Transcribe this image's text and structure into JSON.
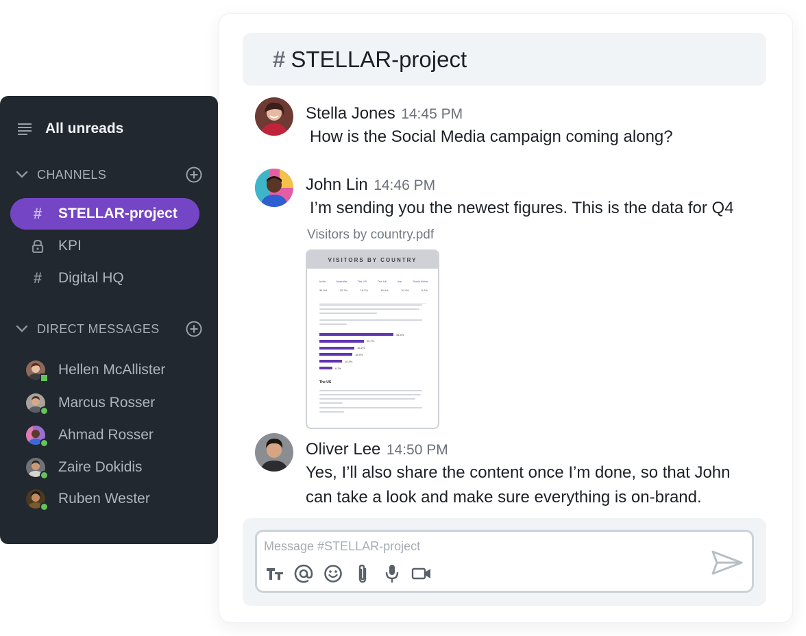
{
  "channel": {
    "hash": "#",
    "name": "STELLAR-project"
  },
  "messages": [
    {
      "author": "Stella Jones",
      "time": "14:45 PM",
      "text": "How is the Social Media campaign coming along?"
    },
    {
      "author": "John Lin",
      "time": "14:46 PM",
      "text": "I’m sending you the newest figures. This is the data for Q4",
      "attachment": {
        "file_name": "Visitors by country.pdf",
        "preview_title": "VISITORS BY COUNTRY",
        "countries": [
          "India",
          "Australia",
          "The US",
          "The UK",
          "Iran",
          "South Africa"
        ],
        "values": [
          "34.5%",
          "20.7%",
          "16.2%",
          "15.4%",
          "10.4%",
          "6.2%"
        ],
        "bar_values": [
          34.5,
          20.7,
          16.2,
          15.4,
          10.4,
          6.2
        ],
        "section_heading": "The US"
      }
    },
    {
      "author": "Oliver Lee",
      "time": "14:50 PM",
      "text_line1": "Yes, I’ll also share the content once I’m done, so that John",
      "text_line2": "can take a look and make sure everything is on-brand."
    }
  ],
  "composer": {
    "placeholder": "Message #STELLAR-project",
    "tools": [
      "text-format-icon",
      "mention-icon",
      "emoji-icon",
      "attach-icon",
      "mic-icon",
      "video-icon"
    ],
    "send_icon": "send-icon"
  },
  "sidebar": {
    "all_unreads": "All unreads",
    "channels_heading": "CHANNELS",
    "channels": [
      {
        "icon": "hash-icon",
        "label": "STELLAR-project",
        "active": true
      },
      {
        "icon": "lock-icon",
        "label": "KPI",
        "active": false
      },
      {
        "icon": "hash-icon",
        "label": "Digital HQ",
        "active": false
      }
    ],
    "dm_heading": "DIRECT MESSAGES",
    "direct_messages": [
      {
        "name": "Hellen McAllister",
        "status": "online"
      },
      {
        "name": "Marcus Rosser",
        "status": "online"
      },
      {
        "name": "Ahmad Rosser",
        "status": "online"
      },
      {
        "name": "Zaire Dokidis",
        "status": "online"
      },
      {
        "name": "Ruben Wester",
        "status": "online"
      }
    ]
  },
  "colors": {
    "accent": "#7446c6",
    "sidebar_bg": "#22282f",
    "status_online": "#64c45b",
    "chart_bar": "#6235b3"
  }
}
